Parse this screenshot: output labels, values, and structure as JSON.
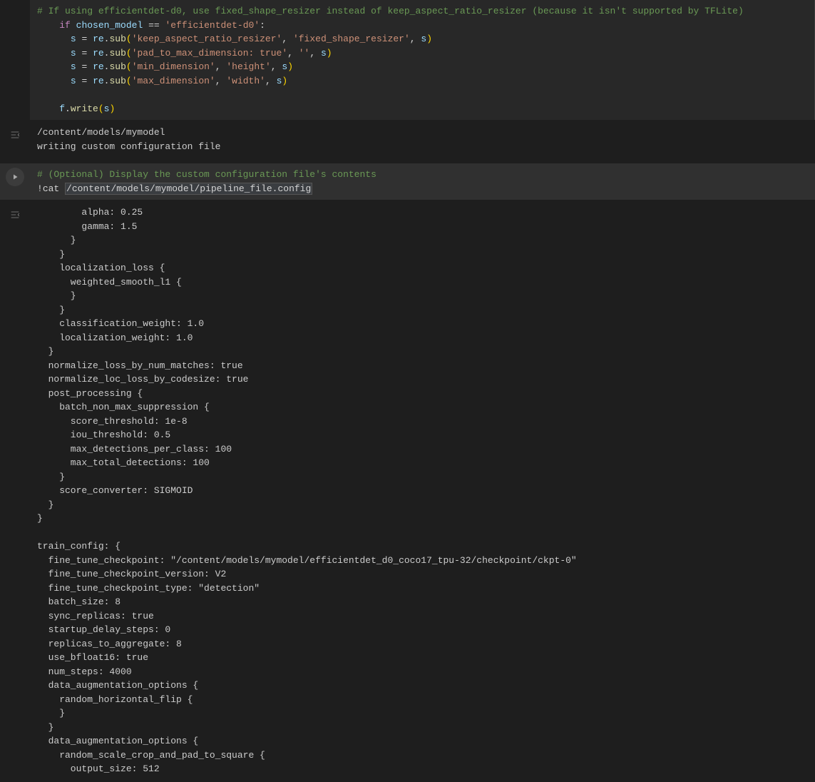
{
  "cell1": {
    "comment1": "# If using efficientdet-d0, use fixed_shape_resizer instead of keep_aspect_ratio_resizer (because it isn't supported by TFLite)",
    "if_kw": "if",
    "chosen_model": "chosen_model",
    "eq": "==",
    "model_str": "'efficientdet-d0'",
    "colon": ":",
    "s": "s",
    "assign": "=",
    "re": "re",
    "sub": "sub",
    "arg1a": "'keep_aspect_ratio_resizer'",
    "arg1b": "'fixed_shape_resizer'",
    "arg2a": "'pad_to_max_dimension: true'",
    "arg2b": "''",
    "arg3a": "'min_dimension'",
    "arg3b": "'height'",
    "arg4a": "'max_dimension'",
    "arg4b": "'width'",
    "f": "f",
    "write": "write",
    "lp": "(",
    "rp": ")",
    "comma": ", ",
    "dot": "."
  },
  "cell1_output": {
    "line1": "/content/models/mymodel",
    "line2": "writing custom configuration file"
  },
  "cell2": {
    "comment": "# (Optional) Display the custom configuration file's contents",
    "bang": "!",
    "cat": "cat ",
    "path": "/content/models/mymodel/pipeline_file.config"
  },
  "cell2_output": "        alpha: 0.25\n        gamma: 1.5\n      }\n    }\n    localization_loss {\n      weighted_smooth_l1 {\n      }\n    }\n    classification_weight: 1.0\n    localization_weight: 1.0\n  }\n  normalize_loss_by_num_matches: true\n  normalize_loc_loss_by_codesize: true\n  post_processing {\n    batch_non_max_suppression {\n      score_threshold: 1e-8\n      iou_threshold: 0.5\n      max_detections_per_class: 100\n      max_total_detections: 100\n    }\n    score_converter: SIGMOID\n  }\n}\n\ntrain_config: {\n  fine_tune_checkpoint: \"/content/models/mymodel/efficientdet_d0_coco17_tpu-32/checkpoint/ckpt-0\"\n  fine_tune_checkpoint_version: V2\n  fine_tune_checkpoint_type: \"detection\"\n  batch_size: 8\n  sync_replicas: true\n  startup_delay_steps: 0\n  replicas_to_aggregate: 8\n  use_bfloat16: true\n  num_steps: 4000\n  data_augmentation_options {\n    random_horizontal_flip {\n    }\n  }\n  data_augmentation_options {\n    random_scale_crop_and_pad_to_square {\n      output_size: 512"
}
